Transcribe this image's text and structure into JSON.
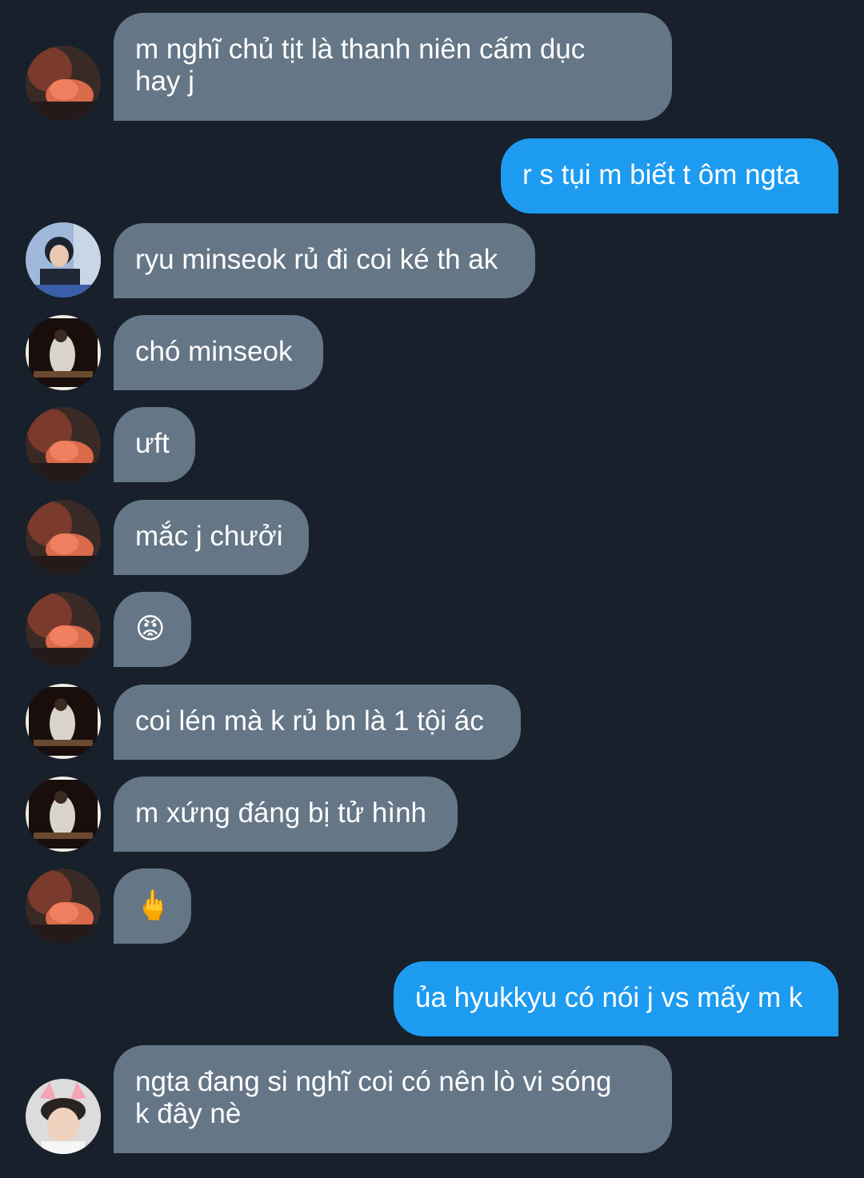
{
  "messages": [
    {
      "side": "in",
      "avatar": "red-mask-avatar",
      "text": "m nghĩ chủ tịt là thanh niên cấm dục\nhay j"
    },
    {
      "side": "out",
      "text": "r s tụi m biết t ôm ngta"
    },
    {
      "side": "in",
      "avatar": "blue-portrait-avatar",
      "text": "ryu minseok rủ đi coi ké th ak"
    },
    {
      "side": "in",
      "avatar": "dark-photo-avatar",
      "text": "chó minseok"
    },
    {
      "side": "in",
      "avatar": "red-mask-avatar",
      "text": "ưft"
    },
    {
      "side": "in",
      "avatar": "red-mask-avatar",
      "text": "mắc j chưởi"
    },
    {
      "side": "in",
      "avatar": "red-mask-avatar",
      "text": "😡"
    },
    {
      "side": "in",
      "avatar": "dark-photo-avatar",
      "text": "coi lén mà k rủ bn là 1 tội ác"
    },
    {
      "side": "in",
      "avatar": "dark-photo-avatar",
      "text": "m xứng đáng bị tử hình"
    },
    {
      "side": "in",
      "avatar": "red-mask-avatar",
      "text": "🖕"
    },
    {
      "side": "out",
      "text": "ủa hyukkyu có nói j vs mấy m k"
    },
    {
      "side": "in",
      "avatar": "cat-ears-avatar",
      "text": "ngta đang si nghĩ coi có nên lò vi sóng\nk đây nè"
    }
  ],
  "colors": {
    "background": "#17202b",
    "incoming_bubble": "#657686",
    "outgoing_bubble": "#1d9bf0",
    "text": "#ffffff"
  }
}
